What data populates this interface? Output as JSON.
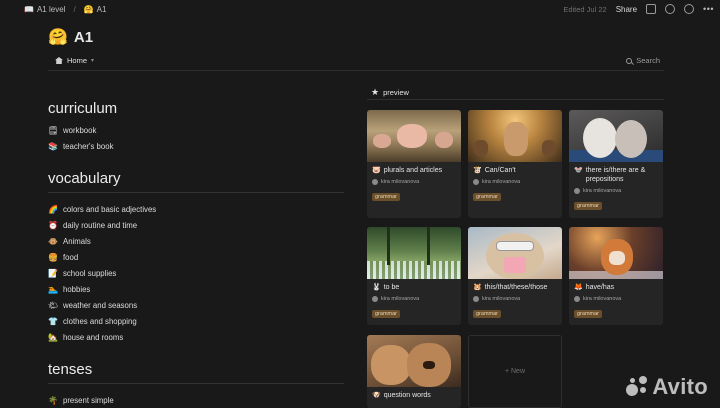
{
  "topbar": {
    "breadcrumb_parent_icon": "book-icon",
    "breadcrumb_parent": "A1 level",
    "breadcrumb_separator": "/",
    "breadcrumb_current_icon": "hugging-face-emoji",
    "breadcrumb_current": "A1",
    "edited": "Edited Jul 22",
    "share": "Share"
  },
  "page": {
    "title_icon": "🤗",
    "title": "A1",
    "tab_home": "Home",
    "search": "Search"
  },
  "curriculum": {
    "heading": "curriculum",
    "items": [
      {
        "icon": "🗒",
        "label": "workbook"
      },
      {
        "icon": "📚",
        "label": "teacher's book"
      }
    ]
  },
  "vocabulary": {
    "heading": "vocabulary",
    "items": [
      {
        "icon": "🌈",
        "label": "colors and basic adjectives"
      },
      {
        "icon": "⏰",
        "label": "daily routine and time"
      },
      {
        "icon": "🐵",
        "label": "Animals"
      },
      {
        "icon": "🍔",
        "label": "food"
      },
      {
        "icon": "📝",
        "label": "school supplies"
      },
      {
        "icon": "🏊",
        "label": "hobbies"
      },
      {
        "icon": "🌤",
        "label": "weather and seasons"
      },
      {
        "icon": "👕",
        "label": "clothes and shopping"
      },
      {
        "icon": "🏡",
        "label": "house and rooms"
      }
    ]
  },
  "tenses": {
    "heading": "tenses",
    "items": [
      {
        "icon": "🌴",
        "label": "present simple"
      }
    ]
  },
  "preview": {
    "label": "preview",
    "cards": [
      {
        "icon": "🐷",
        "title": "plurals and articles",
        "author": "kira milovanova",
        "tag": "grammar"
      },
      {
        "icon": "🐮",
        "title": "Can/Can't",
        "author": "kira milovanova",
        "tag": "grammar"
      },
      {
        "icon": "🐭",
        "title": "there is/there are & prepositions",
        "author": "kira milovanova",
        "tag": "grammar"
      },
      {
        "icon": "🐰",
        "title": "to be",
        "author": "kira milovanova",
        "tag": "grammar"
      },
      {
        "icon": "🐹",
        "title": "this/that/these/those",
        "author": "kira milovanova",
        "tag": "grammar"
      },
      {
        "icon": "🦊",
        "title": "have/has",
        "author": "kira milovanova",
        "tag": "grammar"
      },
      {
        "icon": "🐶",
        "title": "question words"
      }
    ],
    "new_label": "+ New"
  },
  "watermark": "Avito"
}
